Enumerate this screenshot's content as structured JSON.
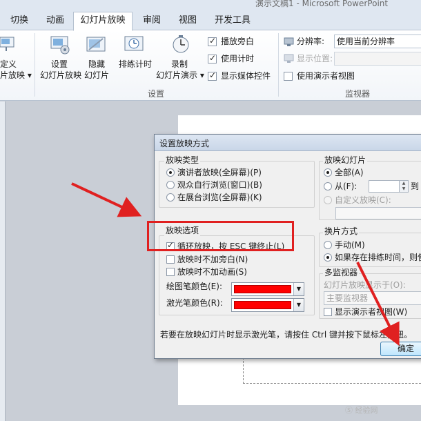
{
  "window": {
    "title": "演示文稿1 - Microsoft PowerPoint"
  },
  "tabs": [
    {
      "label": "切换"
    },
    {
      "label": "动画"
    },
    {
      "label": "幻灯片放映",
      "active": true
    },
    {
      "label": "审阅"
    },
    {
      "label": "视图"
    },
    {
      "label": "开发工具"
    }
  ],
  "ribbon": {
    "custom_show": {
      "line1": "定义",
      "line2": "片放映 ▾"
    },
    "setup_show": {
      "line1": "设置",
      "line2": "幻灯片放映"
    },
    "hide_slide": {
      "line1": "隐藏",
      "line2": "幻灯片"
    },
    "rehearse": {
      "label": "排练计时"
    },
    "record": {
      "line1": "录制",
      "line2": "幻灯片演示 ▾"
    },
    "checks": [
      {
        "label": "播放旁白",
        "checked": true
      },
      {
        "label": "使用计时",
        "checked": true
      },
      {
        "label": "显示媒体控件",
        "checked": true
      }
    ],
    "setup_group_label": "设置",
    "monitors": {
      "resolution_label": "分辨率:",
      "resolution_value": "使用当前分辨率",
      "show_on_label": "显示位置:",
      "presenter_view_label": "使用演示者视图",
      "presenter_view_checked": false,
      "group_label": "监视器"
    }
  },
  "dialog": {
    "title": "设置放映方式",
    "show_type": {
      "legend": "放映类型",
      "options": [
        {
          "label": "演讲者放映(全屏幕)(P)",
          "checked": true
        },
        {
          "label": "观众自行浏览(窗口)(B)",
          "checked": false
        },
        {
          "label": "在展台浏览(全屏幕)(K)",
          "checked": false
        }
      ]
    },
    "show_options": {
      "legend": "放映选项",
      "options": [
        {
          "label": "循环放映，按 ESC 键终止(L)",
          "checked": true
        },
        {
          "label": "放映时不加旁白(N)",
          "checked": false
        },
        {
          "label": "放映时不加动画(S)",
          "checked": false
        }
      ],
      "pen_color_label": "绘图笔颜色(E):",
      "laser_color_label": "激光笔颜色(R):",
      "pen_color": "#ff0000",
      "laser_color": "#ff0000"
    },
    "show_slides": {
      "legend": "放映幻灯片",
      "all_label": "全部(A)",
      "from_label": "从(F):",
      "to_label": "到",
      "custom_label": "自定义放映(C):"
    },
    "advance": {
      "legend": "换片方式",
      "manual_label": "手动(M)",
      "timings_label": "如果存在排练时间，则使"
    },
    "multi_monitor": {
      "legend": "多监视器",
      "display_on_label": "幻灯片放映显示于(O):",
      "display_value": "主要监视器",
      "presenter_view_label": "显示演示者视图(W)"
    },
    "hint": "若要在放映幻灯片时显示激光笔，请按住 Ctrl 键并按下鼠标左按钮。",
    "ok_label": "确定"
  },
  "watermark": "Ⓢ 经验网"
}
